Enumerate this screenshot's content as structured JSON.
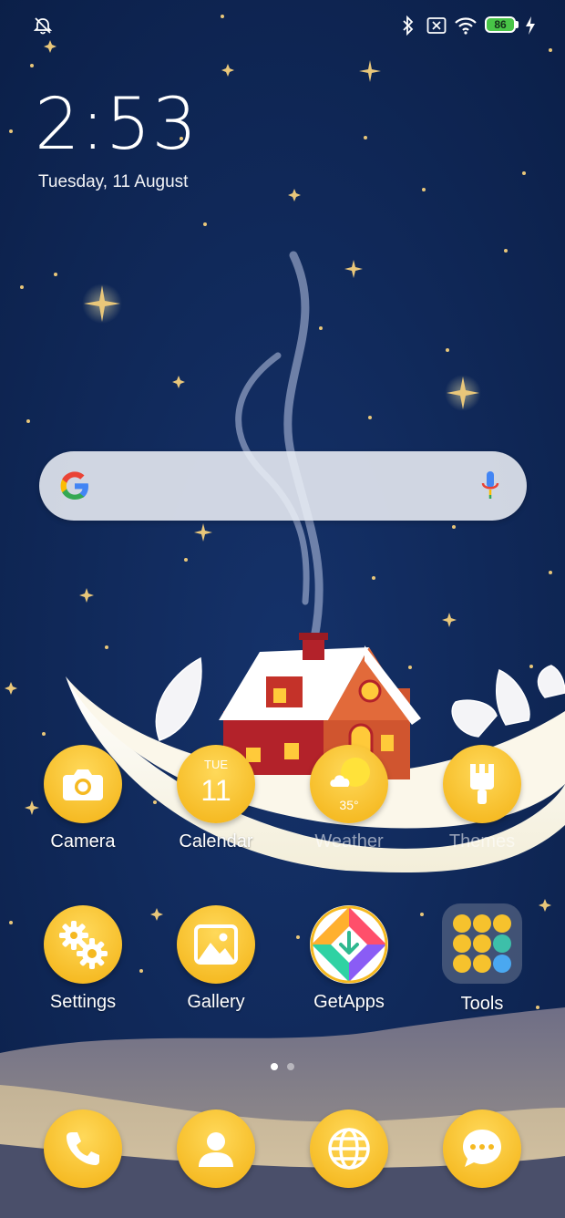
{
  "status_bar": {
    "battery_level": "86",
    "icons": [
      "alarm-off-icon",
      "bluetooth-icon",
      "no-sim-icon",
      "wifi-icon",
      "battery-icon",
      "charging-icon"
    ]
  },
  "clock": {
    "time": "2:53",
    "date": "Tuesday, 11 August"
  },
  "search": {
    "icons": [
      "google-logo-icon",
      "mic-icon"
    ]
  },
  "apps": [
    {
      "label": "Camera",
      "icon": "camera-icon"
    },
    {
      "label": "Calendar",
      "icon": "calendar-icon",
      "day": "TUE",
      "date": "11"
    },
    {
      "label": "Weather",
      "icon": "weather-icon",
      "temp": "35°"
    },
    {
      "label": "Themes",
      "icon": "brush-icon"
    },
    {
      "label": "Settings",
      "icon": "gear-icon"
    },
    {
      "label": "Gallery",
      "icon": "image-icon"
    },
    {
      "label": "GetApps",
      "icon": "getapps-icon"
    },
    {
      "label": "Tools",
      "icon": "folder-icon"
    }
  ],
  "dock": [
    {
      "icon": "phone-icon"
    },
    {
      "icon": "contacts-icon"
    },
    {
      "icon": "browser-icon"
    },
    {
      "icon": "messages-icon"
    }
  ],
  "pager": {
    "current_page": 1,
    "total_pages": 2
  },
  "colors": {
    "background": "#0e2552",
    "icon_yellow": "#f5b921",
    "battery_green": "#48c447"
  }
}
